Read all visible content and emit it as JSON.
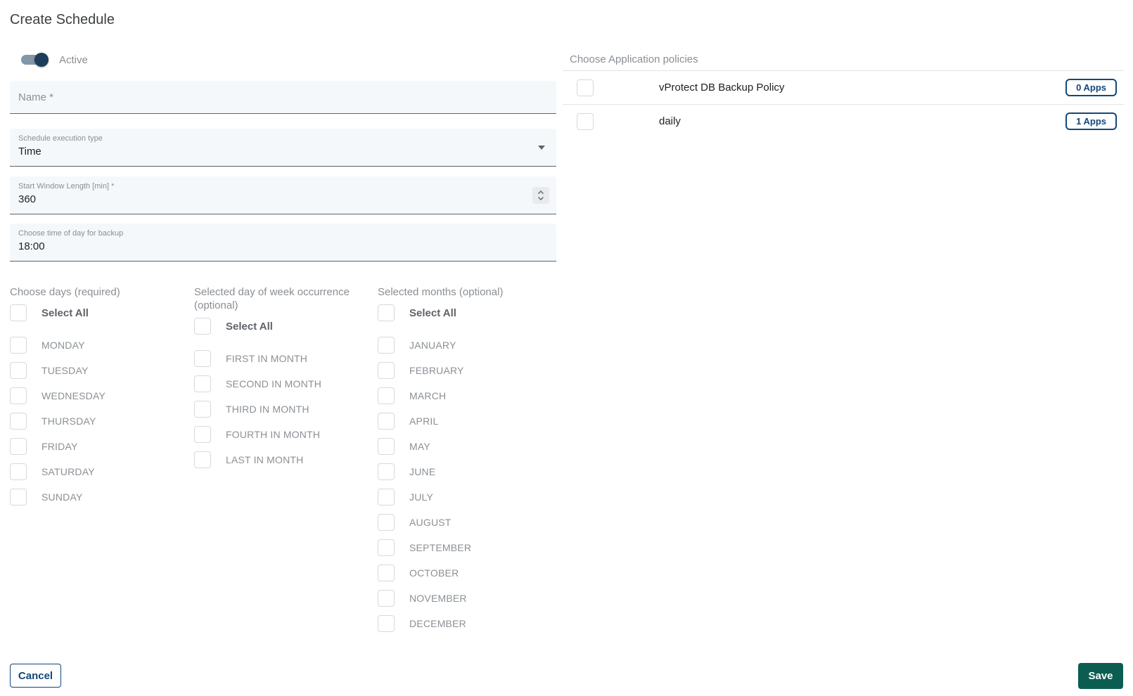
{
  "title": "Create Schedule",
  "toggle": {
    "label": "Active",
    "state": "on"
  },
  "fields": {
    "name": {
      "placeholder": "Name *",
      "value": ""
    },
    "execution_type": {
      "label": "Schedule execution type",
      "value": "Time"
    },
    "start_window": {
      "label": "Start Window Length [min] *",
      "value": "360"
    },
    "time_of_day": {
      "label": "Choose time of day for backup",
      "value": "18:00"
    }
  },
  "days": {
    "header": "Choose days (required)",
    "select_all_label": "Select All",
    "items": [
      "MONDAY",
      "TUESDAY",
      "WEDNESDAY",
      "THURSDAY",
      "FRIDAY",
      "SATURDAY",
      "SUNDAY"
    ]
  },
  "occurrence": {
    "header": "Selected day of week occurrence (optional)",
    "select_all_label": "Select All",
    "items": [
      "FIRST IN MONTH",
      "SECOND IN MONTH",
      "THIRD IN MONTH",
      "FOURTH IN MONTH",
      "LAST IN MONTH"
    ]
  },
  "months": {
    "header": "Selected months (optional)",
    "select_all_label": "Select All",
    "items": [
      "JANUARY",
      "FEBRUARY",
      "MARCH",
      "APRIL",
      "MAY",
      "JUNE",
      "JULY",
      "AUGUST",
      "SEPTEMBER",
      "OCTOBER",
      "NOVEMBER",
      "DECEMBER"
    ]
  },
  "policies": {
    "header": "Choose Application policies",
    "items": [
      {
        "name": "vProtect DB Backup Policy",
        "badge": "0 Apps"
      },
      {
        "name": "daily",
        "badge": "1 Apps"
      }
    ]
  },
  "actions": {
    "cancel": "Cancel",
    "save": "Save"
  },
  "colors": {
    "navy": "#12477A",
    "toggle_thumb": "#1C3E5A",
    "toggle_track": "#8296A7",
    "save_green": "#0B5D51",
    "field_bg": "#F5F8FA",
    "field_border": "#5F6368",
    "text_dark": "#202124",
    "text_gray": "#8A8F94",
    "divider": "#E1E3E6",
    "checkbox_border": "#D6D9DC"
  }
}
